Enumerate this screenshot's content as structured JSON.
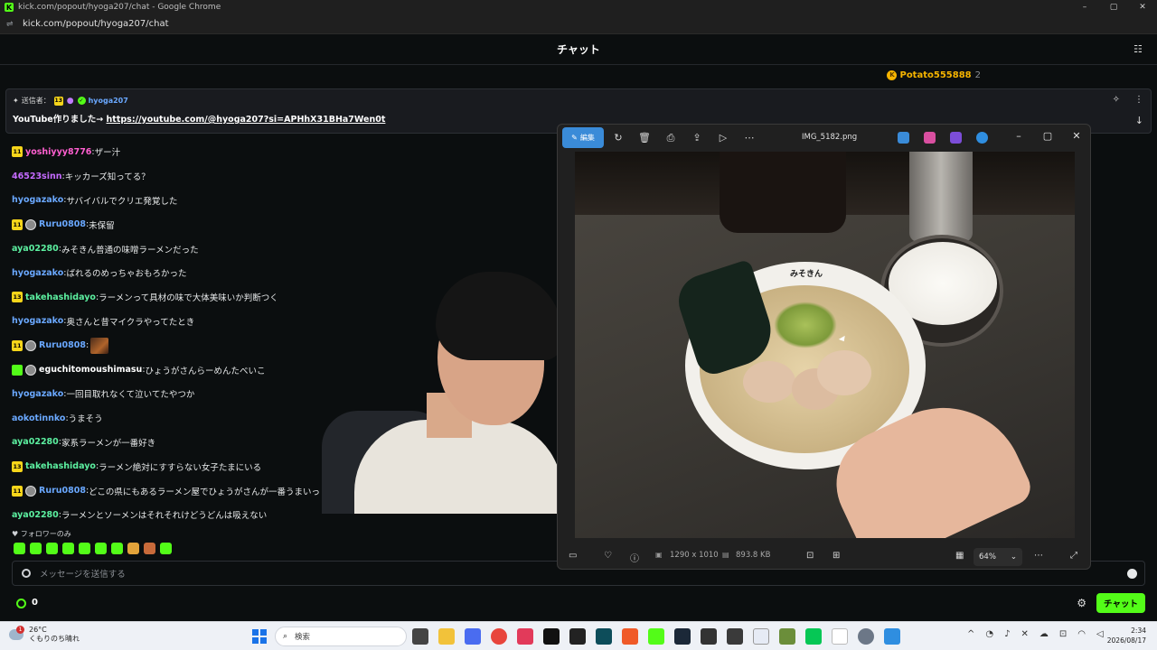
{
  "browser": {
    "window_title": "kick.com/popout/hyoga207/chat - Google Chrome",
    "url": "kick.com/popout/hyoga207/chat",
    "controls": [
      "–",
      "▢",
      "✕"
    ]
  },
  "chat": {
    "header_title": "チャット",
    "top_gifter": {
      "name": "Potato555888",
      "count": "2"
    },
    "pinned": {
      "sender_label": "送信者：",
      "badge": "13",
      "username": "hyoga207",
      "text": "YouTube作りました→ ",
      "link": "https://youtube.com/@hyoga207?si=APHhX31BHa7Wen0t"
    },
    "messages": [
      {
        "badge": "11",
        "avatar": false,
        "user": "yoshiyyy8776",
        "color": "#ff5fd0",
        "text": "ザー汁"
      },
      {
        "badge": "",
        "avatar": false,
        "user": "46523sinn",
        "color": "#c56bff",
        "text": "キッカーズ知ってる？"
      },
      {
        "badge": "",
        "avatar": false,
        "user": "hyogazako",
        "color": "#6aa8ff",
        "text": "サバイバルでクリエ発覚した"
      },
      {
        "badge": "11",
        "avatar": true,
        "user": "Ruru0808",
        "color": "#6aa8ff",
        "text": "未保留"
      },
      {
        "badge": "",
        "avatar": false,
        "user": "aya02280",
        "color": "#5cf0a0",
        "text": "みそきん普通の味噌ラーメンだった"
      },
      {
        "badge": "",
        "avatar": false,
        "user": "hyogazako",
        "color": "#6aa8ff",
        "text": "ばれるのめっちゃおもろかった"
      },
      {
        "badge": "13",
        "avatar": false,
        "user": "takehashidayo",
        "color": "#5cf0a0",
        "text": "ラーメンって具材の味で大体美味いか判断つく"
      },
      {
        "badge": "",
        "avatar": false,
        "user": "hyogazako",
        "color": "#6aa8ff",
        "text": "奥さんと昔マイクラやってたとき"
      },
      {
        "badge": "11",
        "avatar": true,
        "user": "Ruru0808",
        "color": "#6aa8ff",
        "text": "",
        "emote": true
      },
      {
        "badge": "green",
        "avatar": true,
        "user": "eguchitomoushimasu",
        "color": "#ffffff",
        "text": "ひょうがさんらーめんたべいこ"
      },
      {
        "badge": "",
        "avatar": false,
        "user": "hyogazako",
        "color": "#6aa8ff",
        "text": "一回目取れなくて泣いてたやつか"
      },
      {
        "badge": "",
        "avatar": false,
        "user": "aokotinnko",
        "color": "#6aa8ff",
        "text": "うまそう"
      },
      {
        "badge": "",
        "avatar": false,
        "user": "aya02280",
        "color": "#5cf0a0",
        "text": "家系ラーメンが一番好き"
      },
      {
        "badge": "13",
        "avatar": false,
        "user": "takehashidayo",
        "color": "#5cf0a0",
        "text": "ラーメン絶対にすすらない女子たまにいる"
      },
      {
        "badge": "11",
        "avatar": true,
        "user": "Ruru0808",
        "color": "#6aa8ff",
        "text": "どこの県にもあるラーメン屋でひょうがさんが一番うまいっ"
      },
      {
        "badge": "",
        "avatar": false,
        "user": "aya02280",
        "color": "#5cf0a0",
        "text": "ラーメンとソーメンはそれそれけどうどんは吸えない"
      }
    ],
    "followers_only": "♥ フォロワーのみ",
    "input_placeholder": "メッセージを送信する",
    "points": "0",
    "send_button": "チャット"
  },
  "photos": {
    "edit_label": "編集",
    "filename": "IMG_5182.png",
    "dimensions": "1290 x 1010",
    "filesize": "893.8 KB",
    "zoom": "64%",
    "bowl_text": "みそきん"
  },
  "taskbar": {
    "temperature": "26°C",
    "weather": "くもりのち晴れ",
    "alert_count": "1",
    "search_placeholder": "検索",
    "time": "2:34",
    "date": "2026/08/17"
  }
}
